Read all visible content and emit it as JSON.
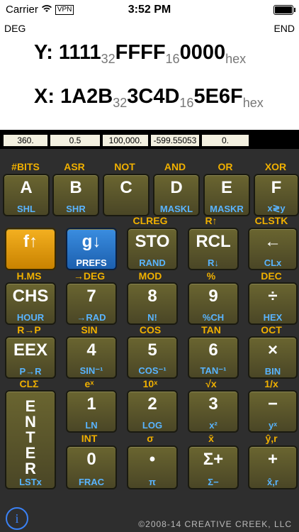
{
  "status": {
    "carrier": "Carrier",
    "vpn": "VPN",
    "time": "3:52 PM"
  },
  "display": {
    "mode_left": "DEG",
    "mode_right": "END",
    "y_label": "Y:",
    "y_parts": [
      "1111",
      "32",
      "FFFF",
      "16",
      "0000",
      "hex"
    ],
    "x_label": "X:",
    "x_parts": [
      "1A2B",
      "32",
      "3C4D",
      "16",
      "5E6F",
      "hex"
    ]
  },
  "registers": [
    "360.",
    "0.5",
    "100,000.",
    "-599.55053",
    "0."
  ],
  "rows": [
    {
      "top": [
        "#BITS",
        "ASR",
        "NOT",
        "AND",
        "OR",
        "XOR"
      ],
      "keys": [
        {
          "f": "A",
          "b": "SHL"
        },
        {
          "f": "B",
          "b": "SHR"
        },
        {
          "f": "C",
          "b": ""
        },
        {
          "f": "D",
          "b": "MASKL"
        },
        {
          "f": "E",
          "b": "MASKR"
        },
        {
          "f": "F",
          "b": "x≷y"
        }
      ]
    },
    {
      "top": [
        "",
        "",
        "CLREG",
        "R↑",
        "CLSTK",
        ""
      ],
      "keys": [
        {
          "f": "f↑",
          "b": ""
        },
        {
          "f": "g↓",
          "b": "PREFS"
        },
        {
          "f": "STO",
          "b": "RAND"
        },
        {
          "f": "RCL",
          "b": "R↓"
        },
        {
          "f": "←",
          "b": "CLx"
        }
      ]
    },
    {
      "top": [
        "H.MS",
        "→DEG",
        "MOD",
        "%",
        "DEC"
      ],
      "keys": [
        {
          "f": "CHS",
          "b": "HOUR"
        },
        {
          "f": "7",
          "b": "→RAD"
        },
        {
          "f": "8",
          "b": "N!"
        },
        {
          "f": "9",
          "b": "%CH"
        },
        {
          "f": "÷",
          "b": "HEX"
        }
      ]
    },
    {
      "top": [
        "R→P",
        "SIN",
        "COS",
        "TAN",
        "OCT"
      ],
      "keys": [
        {
          "f": "EEX",
          "b": "P→R"
        },
        {
          "f": "4",
          "b": "SIN⁻¹"
        },
        {
          "f": "5",
          "b": "COS⁻¹"
        },
        {
          "f": "6",
          "b": "TAN⁻¹"
        },
        {
          "f": "×",
          "b": "BIN"
        }
      ]
    },
    {
      "top": [
        "CLΣ",
        "eˣ",
        "10ˣ",
        "√x",
        "1/x"
      ],
      "keys": [
        {
          "f": "ENTER",
          "b": "LSTx"
        },
        {
          "f": "1",
          "b": "LN"
        },
        {
          "f": "2",
          "b": "LOG"
        },
        {
          "f": "3",
          "b": "x²"
        },
        {
          "f": "−",
          "b": "yˣ"
        }
      ]
    },
    {
      "top": [
        "INT",
        "σ",
        "x̄",
        "ŷ,r"
      ],
      "keys": [
        {
          "f": "0",
          "b": "FRAC"
        },
        {
          "f": "•",
          "b": "π"
        },
        {
          "f": "Σ+",
          "b": "Σ−"
        },
        {
          "f": "+",
          "b": "x̂,r"
        }
      ]
    }
  ],
  "footer": {
    "info": "i",
    "copyright": "©2008-14 CREATIVE CREEK, LLC"
  }
}
